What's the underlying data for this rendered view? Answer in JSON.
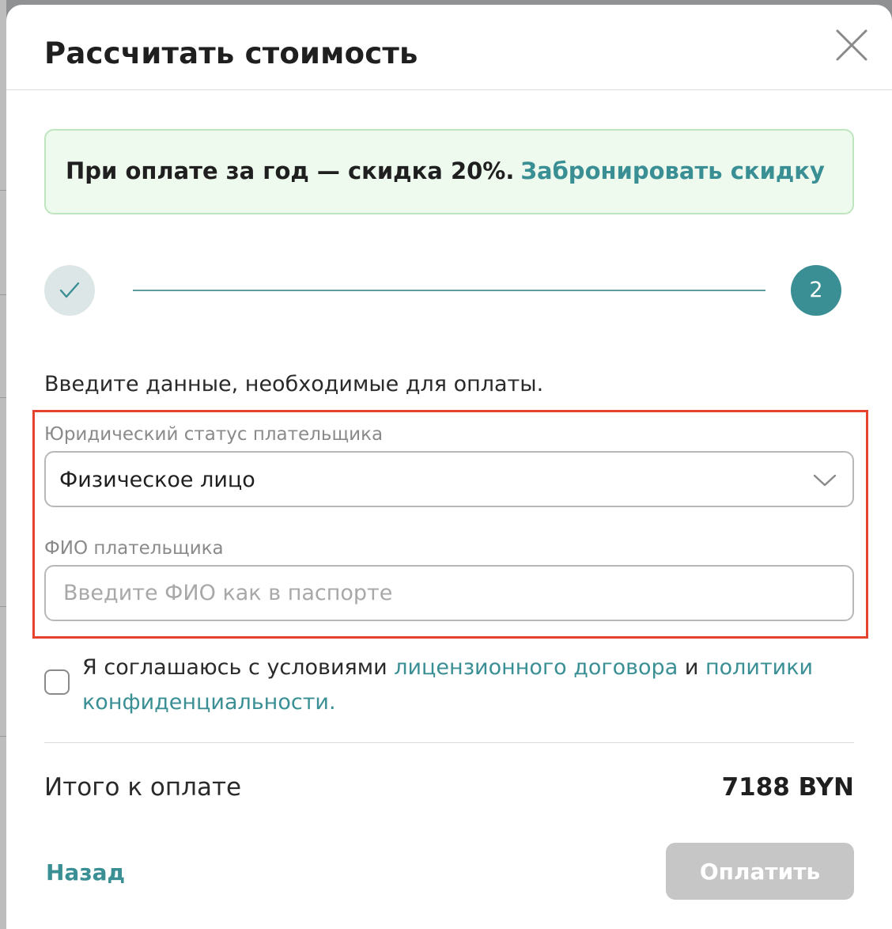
{
  "modal": {
    "title": "Рассчитать стоимость"
  },
  "promo": {
    "text": "При оплате за год — скидка 20%.",
    "link_label": "Забронировать скидку"
  },
  "stepper": {
    "current_step_label": "2"
  },
  "form": {
    "instruction": "Введите данные, необходимые для оплаты.",
    "status_label": "Юридический статус плательщика",
    "status_value": "Физическое лицо",
    "name_label": "ФИО плательщика",
    "name_placeholder": "Введите ФИО как в паспорте",
    "name_value": ""
  },
  "agreement": {
    "checked": false,
    "prefix": "Я соглашаюсь с условиями ",
    "license_link": "лицензионного договора",
    "conjunction": " и ",
    "privacy_link": "политики конфиденциальности."
  },
  "summary": {
    "total_label": "Итого к оплате",
    "total_value": "7188 BYN"
  },
  "actions": {
    "back_label": "Назад",
    "pay_label": "Оплатить",
    "pay_enabled": false
  },
  "colors": {
    "accent": "#3a8f94",
    "promo_bg": "#effaee",
    "highlight_border": "#e5432d",
    "disabled_button": "#c6c6c6"
  }
}
